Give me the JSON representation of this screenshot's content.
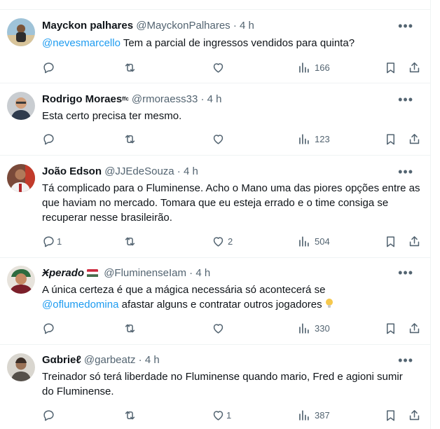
{
  "tweets": [
    {
      "name": "Mayckon palhares",
      "handle": "@MayckonPalhares",
      "time": "4 h",
      "mention": "@nevesmarcello",
      "text": " Tem a parcial de ingressos vendidos para quinta?",
      "replies": "",
      "likes": "",
      "views": "166"
    },
    {
      "name": "Rodrigo Moraes",
      "badge": "ᶠᶠᶜ",
      "handle": "@rmoraess33",
      "time": "4 h",
      "text": "Esta certo precisa ter mesmo.",
      "replies": "",
      "likes": "",
      "views": "123"
    },
    {
      "name": "João Edson",
      "handle": "@JJEdeSouza",
      "time": "4 h",
      "text": "Tá complicado para o Fluminense. Acho o Mano uma das piores opções entre as que haviam no mercado. Tomara que eu esteja errado e o time consiga se recuperar nesse brasileirão.",
      "replies": "1",
      "likes": "2",
      "views": "504"
    },
    {
      "name": "Ӿperado",
      "handle": "@FluminenseIam",
      "time": "4 h",
      "text_before": "A única certeza é que a mágica necessária só acontecerá se",
      "mention": "@oflumedomina",
      "text_after": " afastar alguns e contratar outros jogadores",
      "replies": "",
      "likes": "",
      "views": "330"
    },
    {
      "name": "Gαbrieℓ",
      "handle": "@garbeatz",
      "time": "4 h",
      "text": "Treinador só terá liberdade no Fluminense quando mario, Fred e agioni sumir do Fluminense.",
      "replies": "",
      "likes": "1",
      "views": "387"
    }
  ],
  "separator": " · ",
  "more_glyph": "•••",
  "colors": {
    "text": "#0f1419",
    "secondary": "#536471",
    "link": "#1d9bf0",
    "divider": "#eff3f4"
  },
  "icons": [
    "reply-icon",
    "retweet-icon",
    "like-icon",
    "views-icon",
    "bookmark-icon",
    "share-icon",
    "more-icon"
  ]
}
